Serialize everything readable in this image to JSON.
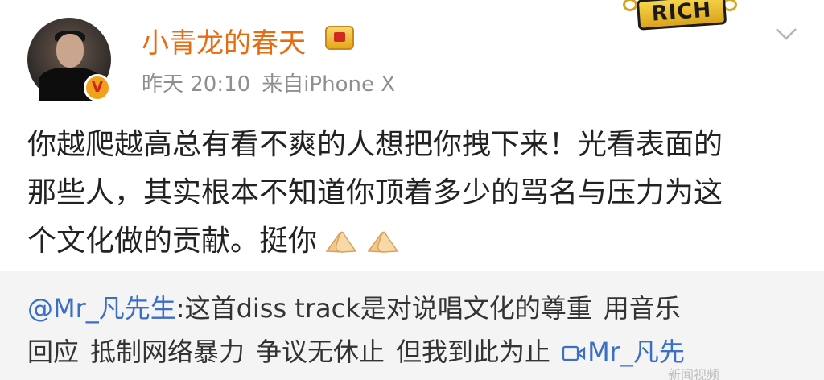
{
  "post": {
    "username": "小青龙的春天",
    "verified_mark": "V",
    "meta_time": "昨天 20:10",
    "meta_source": "来自iPhone X",
    "badge_text": "RICH",
    "content_lines": [
      "你越爬越高总有看不爽的人想把你拽下来！光看表面的",
      "那些人，其实根本不知道你顶着多少的骂名与压力为这",
      "个文化做的贡献。挺你"
    ],
    "emoji": [
      "folded-hands",
      "folded-hands"
    ]
  },
  "repost": {
    "mention": "@Mr_凡先生",
    "line1_text": ":这首diss track是对说唱文化的尊重",
    "line1_tail": "用音乐",
    "line2_a": "回应",
    "line2_b": "抵制网络暴力",
    "line2_c": "争议无休止",
    "line2_d": "但我到此为止",
    "link_text": "Mr_凡先"
  },
  "watermark": "新闻视频",
  "colors": {
    "username": "#e86b10",
    "meta": "#8f8f8f",
    "mention": "#3b6ec5",
    "repost_bg": "#f4f4f4"
  },
  "icons": {
    "crown": "crown-vip-icon",
    "verified": "verified-v-icon",
    "chevron": "chevron-down-icon",
    "link": "video-link-icon"
  }
}
